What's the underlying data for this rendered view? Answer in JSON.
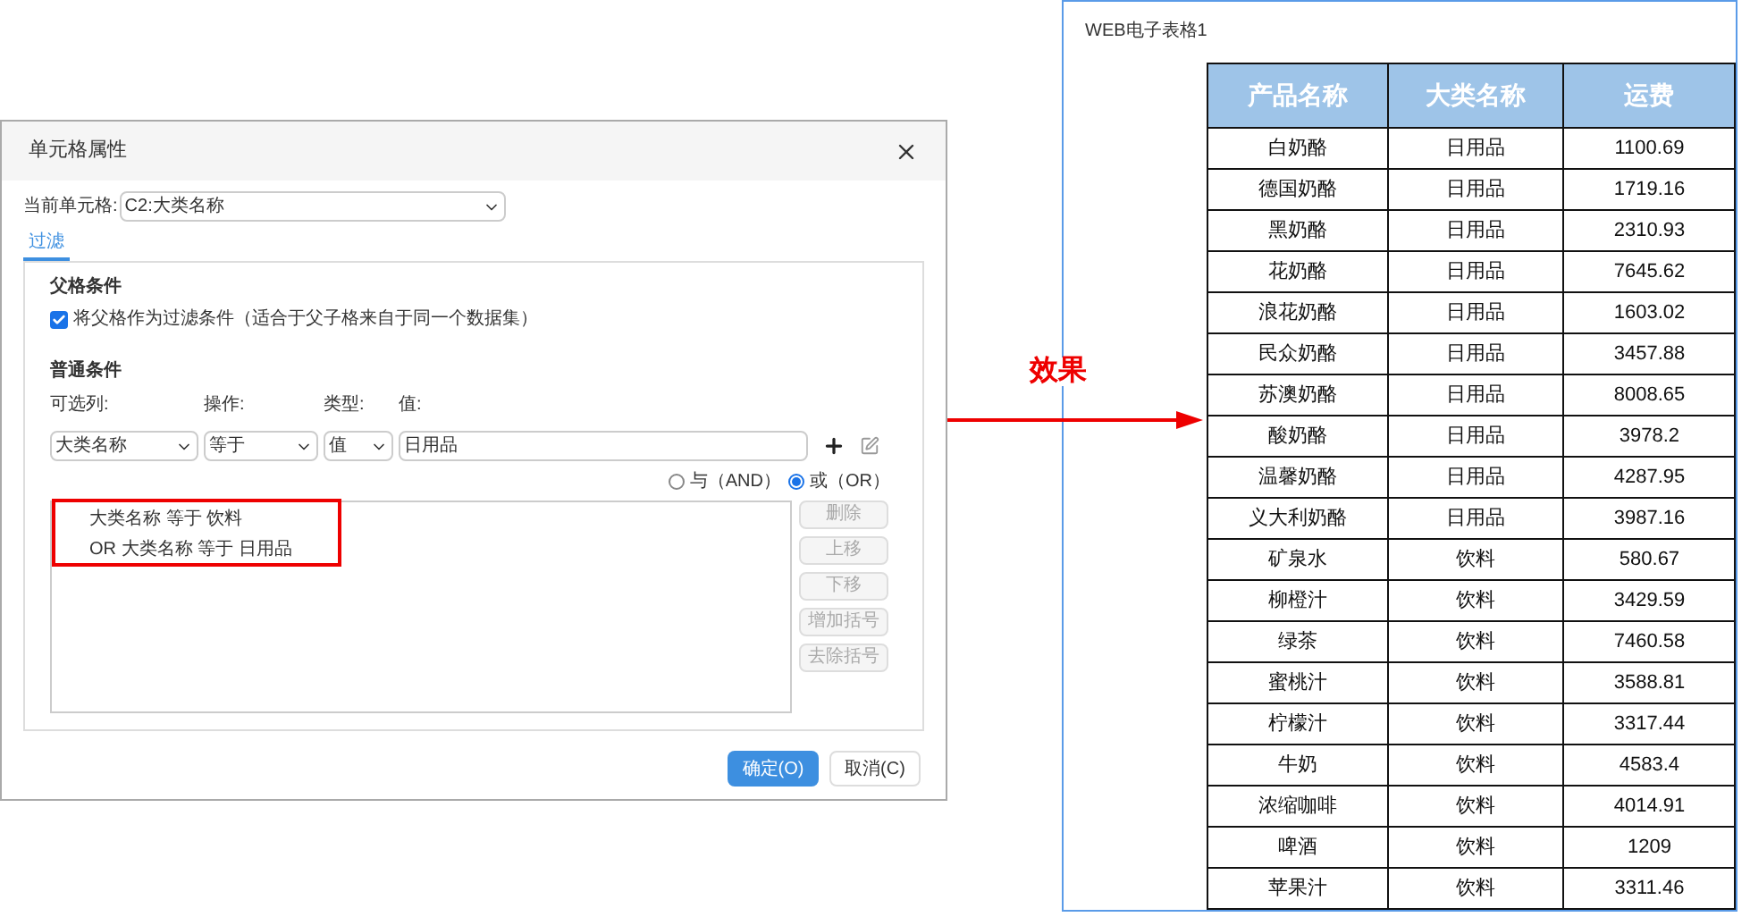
{
  "dialog": {
    "title": "单元格属性",
    "current_cell": {
      "label": "当前单元格:",
      "value": "C2:大类名称"
    },
    "tabs": [
      {
        "label": "过滤",
        "selected": true
      }
    ],
    "parent_section": {
      "title": "父格条件",
      "checkbox": {
        "label": "将父格作为过滤条件（适合于父子格来自于同一个数据集）",
        "checked": true
      }
    },
    "normal_section": {
      "title": "普通条件",
      "column_label": "可选列:",
      "operation_label": "操作:",
      "type_label": "类型:",
      "value_label": "值:",
      "column": "大类名称",
      "operation": "等于",
      "type": "值",
      "value": "日用品",
      "logic": [
        {
          "label": "与（AND）",
          "selected": false
        },
        {
          "label": "或（OR）",
          "selected": true
        }
      ],
      "conditions": [
        "大类名称 等于 饮料",
        "OR 大类名称 等于 日用品"
      ],
      "side_buttons": [
        "删除",
        "上移",
        "下移",
        "增加括号",
        "去除括号"
      ]
    },
    "buttons": [
      {
        "label": "确定(O)",
        "primary": true
      },
      {
        "label": "取消(C)",
        "primary": false
      }
    ]
  },
  "arrow_label": "效果",
  "report": {
    "title": "WEB电子表格1",
    "columns": [
      "产品名称",
      "大类名称",
      "运费"
    ],
    "rows": [
      [
        "白奶酪",
        "日用品",
        "1100.69"
      ],
      [
        "德国奶酪",
        "日用品",
        "1719.16"
      ],
      [
        "黑奶酪",
        "日用品",
        "2310.93"
      ],
      [
        "花奶酪",
        "日用品",
        "7645.62"
      ],
      [
        "浪花奶酪",
        "日用品",
        "1603.02"
      ],
      [
        "民众奶酪",
        "日用品",
        "3457.88"
      ],
      [
        "苏澳奶酪",
        "日用品",
        "8008.65"
      ],
      [
        "酸奶酪",
        "日用品",
        "3978.2"
      ],
      [
        "温馨奶酪",
        "日用品",
        "4287.95"
      ],
      [
        "义大利奶酪",
        "日用品",
        "3987.16"
      ],
      [
        "矿泉水",
        "饮料",
        "580.67"
      ],
      [
        "柳橙汁",
        "饮料",
        "3429.59"
      ],
      [
        "绿茶",
        "饮料",
        "7460.58"
      ],
      [
        "蜜桃汁",
        "饮料",
        "3588.81"
      ],
      [
        "柠檬汁",
        "饮料",
        "3317.44"
      ],
      [
        "牛奶",
        "饮料",
        "4583.4"
      ],
      [
        "浓缩咖啡",
        "饮料",
        "4014.91"
      ],
      [
        "啤酒",
        "饮料",
        "1209"
      ],
      [
        "苹果汁",
        "饮料",
        "3311.46"
      ]
    ]
  }
}
